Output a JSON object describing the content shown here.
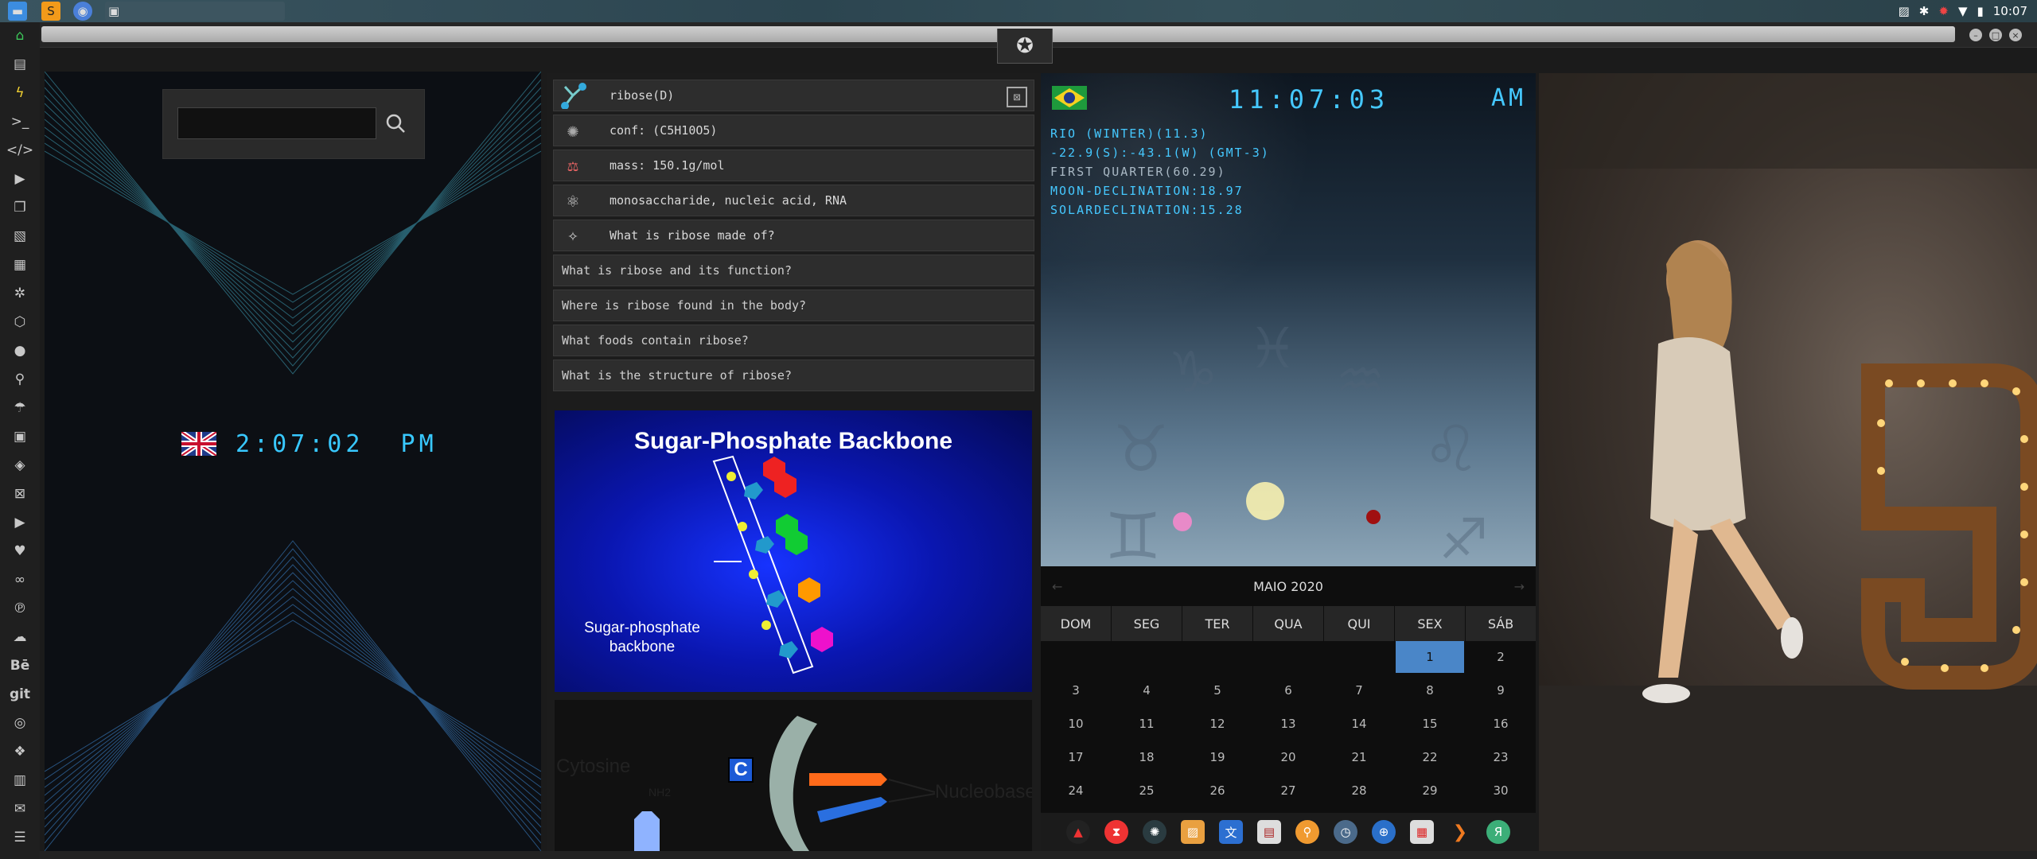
{
  "system": {
    "time": "10:07",
    "tray_icons": [
      "image-icon",
      "bluetooth-icon",
      "bug-icon",
      "wifi-icon",
      "battery-icon"
    ],
    "apps": [
      "files-icon",
      "sublime-icon",
      "chrome-icon",
      "window-icon"
    ]
  },
  "left_dock": [
    "home-icon",
    "document-icon",
    "lightning-icon",
    "terminal-icon",
    "code-icon",
    "play-icon",
    "copy-icon",
    "image-icon",
    "news-icon",
    "settings-icon",
    "hexagon-icon",
    "globe-icon",
    "search-icon",
    "umbrella-icon",
    "contact-icon",
    "tag-icon",
    "network-icon",
    "youtube-icon",
    "heart-icon",
    "infinity-icon",
    "pinterest-icon",
    "cloud-icon",
    "behance-icon",
    "git-icon",
    "github-icon",
    "dropbox-icon",
    "map-icon",
    "mail-icon",
    "server-icon"
  ],
  "dock_labels": {
    "behance": "Bē",
    "git": "git"
  },
  "panel1": {
    "search_placeholder": "",
    "clock": "2:07:02  PM"
  },
  "panel2": {
    "rows": [
      {
        "text": "ribose(D)"
      },
      {
        "text": "conf: (C5H10O5)"
      },
      {
        "text": "mass: 150.1g/mol"
      },
      {
        "text": "monosaccharide, nucleic acid, RNA"
      },
      {
        "text": "What is ribose made of?"
      }
    ],
    "questions": [
      "What is ribose and its function?",
      "Where is ribose found in the body?",
      "What foods contain ribose?",
      "What is the structure of ribose?"
    ],
    "image1": {
      "title": "Sugar-Phosphate Backbone",
      "label_line1": "Sugar-phosphate",
      "label_line2": "backbone"
    },
    "image2": {
      "label_left": "Cytosine",
      "label_nh2": "NH2",
      "c_badge": "C",
      "label_right": "Nucleobase"
    }
  },
  "panel3": {
    "time": "11:07:03",
    "ampm": "AM",
    "lines": [
      "RIO (WINTER)(11.3)",
      "-22.9(S):-43.1(W) (GMT-3)",
      "FIRST QUARTER(60.29)",
      "MOON-DECLINATION:18.97",
      "SOLARDECLINATION:15.28"
    ],
    "calendar": {
      "month": "MAIO 2020",
      "prev": "←",
      "next": "→",
      "weekdays": [
        "DOM",
        "SEG",
        "TER",
        "QUA",
        "QUI",
        "SEX",
        "SÁB"
      ],
      "weeks": [
        [
          "",
          "",
          "",
          "",
          "",
          "1",
          "2"
        ],
        [
          "3",
          "4",
          "5",
          "6",
          "7",
          "8",
          "9"
        ],
        [
          "10",
          "11",
          "12",
          "13",
          "14",
          "15",
          "16"
        ],
        [
          "17",
          "18",
          "19",
          "20",
          "21",
          "22",
          "23"
        ],
        [
          "24",
          "25",
          "26",
          "27",
          "28",
          "29",
          "30"
        ]
      ],
      "selected": "1"
    }
  },
  "dock": [
    "adobe-icon",
    "hourglass-icon",
    "orb-icon",
    "preview-icon",
    "translate-icon",
    "reader-icon",
    "finder-icon",
    "clock-icon",
    "globe-icon",
    "calendar-icon",
    "arrow-icon",
    "yandex-icon"
  ]
}
